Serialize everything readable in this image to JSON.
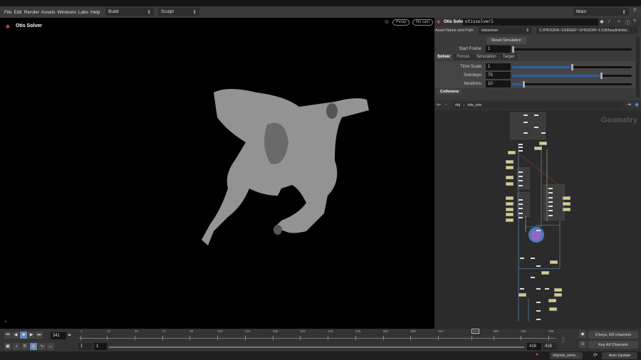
{
  "menubar": {
    "items": [
      "File",
      "Edit",
      "Render",
      "Assets",
      "Windows",
      "Labs",
      "Help"
    ],
    "desktop": "Build",
    "shelf": "Sculpt",
    "main": "Main"
  },
  "viewport": {
    "title": "Otis Solver",
    "camera": "Persp",
    "cam_menu": "No cam"
  },
  "params": {
    "node_type": "Otis Solver",
    "node_name": "otissolver1",
    "asset_label": "Asset Name and Path",
    "asset_name": "otissolver",
    "asset_path": "C:/PROGRA~1/SIDEEF~1/HOUDIN~1.518/houdini/otls/...",
    "reset": "Reset Simulation",
    "start_frame_label": "Start Frame",
    "start_frame": "1",
    "tabs": [
      "Solver",
      "Forces",
      "Simulation",
      "Target"
    ],
    "rows": [
      {
        "label": "Time Scale",
        "value": "1",
        "fraction": 0.5
      },
      {
        "label": "Substeps",
        "value": "75",
        "fraction": 0.75
      },
      {
        "label": "Iterations",
        "value": "10",
        "fraction": 0.09
      }
    ],
    "collisions": "Collisions"
  },
  "network": {
    "path": [
      "obj",
      "otis_sim"
    ],
    "context": "Geometry"
  },
  "timeline": {
    "current_frame": "341",
    "ticks": [
      "1",
      "24",
      "48",
      "72",
      "96",
      "120",
      "144",
      "168",
      "192",
      "216",
      "240",
      "264",
      "288",
      "312",
      "341",
      "360",
      "384",
      "408"
    ],
    "range_start": "1",
    "range_start2": "1",
    "range_end": "416",
    "range_end2": "416",
    "keys": "0 keys, 0/0 channels",
    "key_all": "Key All Channels"
  },
  "status": {
    "path": "/obj/otis_sim/o...",
    "update": "Auto Update"
  },
  "colors": {
    "accent": "#2a5ea8",
    "note": "#d8cf7a"
  }
}
